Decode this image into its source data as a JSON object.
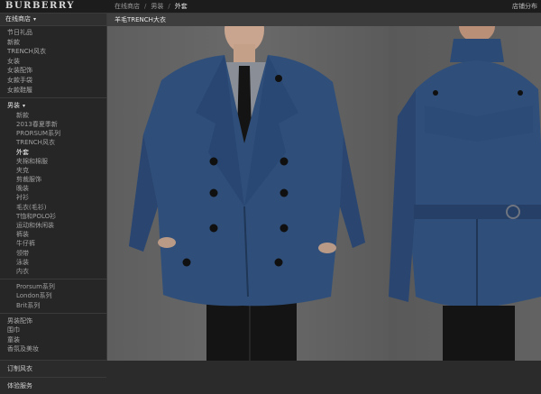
{
  "header": {
    "logo": "BURBERRY",
    "breadcrumb": [
      "在线商店",
      "男装",
      "外套"
    ],
    "store_locator": "店铺分布"
  },
  "sidebar": {
    "heading": "在线商店",
    "top_items": [
      "节日礼品",
      "新款",
      "TRENCH风衣",
      "女装",
      "女装配饰",
      "女款手袋",
      "女款鞋履"
    ],
    "section_label": "男装",
    "sub_items": [
      "新款",
      "2013春夏季新",
      "PRORSUM系列",
      "TRENCH风衣",
      "外套",
      "夹棉和棉服",
      "夹克",
      "剪裁服饰",
      "晚装",
      "衬衫",
      "毛衣(毛衫)",
      "T恤和POLO衫",
      "运动和休闲装",
      "裤装",
      "牛仔裤",
      "领带",
      "泳装",
      "内衣"
    ],
    "lines": [
      "Prorsum系列",
      "London系列",
      "Brit系列"
    ],
    "more_items": [
      "男装配饰",
      "围巾",
      "童装",
      "香氛及美妆"
    ],
    "bottom_links": [
      "订制风衣",
      "体验服务"
    ],
    "active_sub": "外套"
  },
  "main": {
    "title": "羊毛TRENCH大衣"
  },
  "colors": {
    "coat_blue": "#2f4f7a",
    "background": "#2b2b2b"
  }
}
